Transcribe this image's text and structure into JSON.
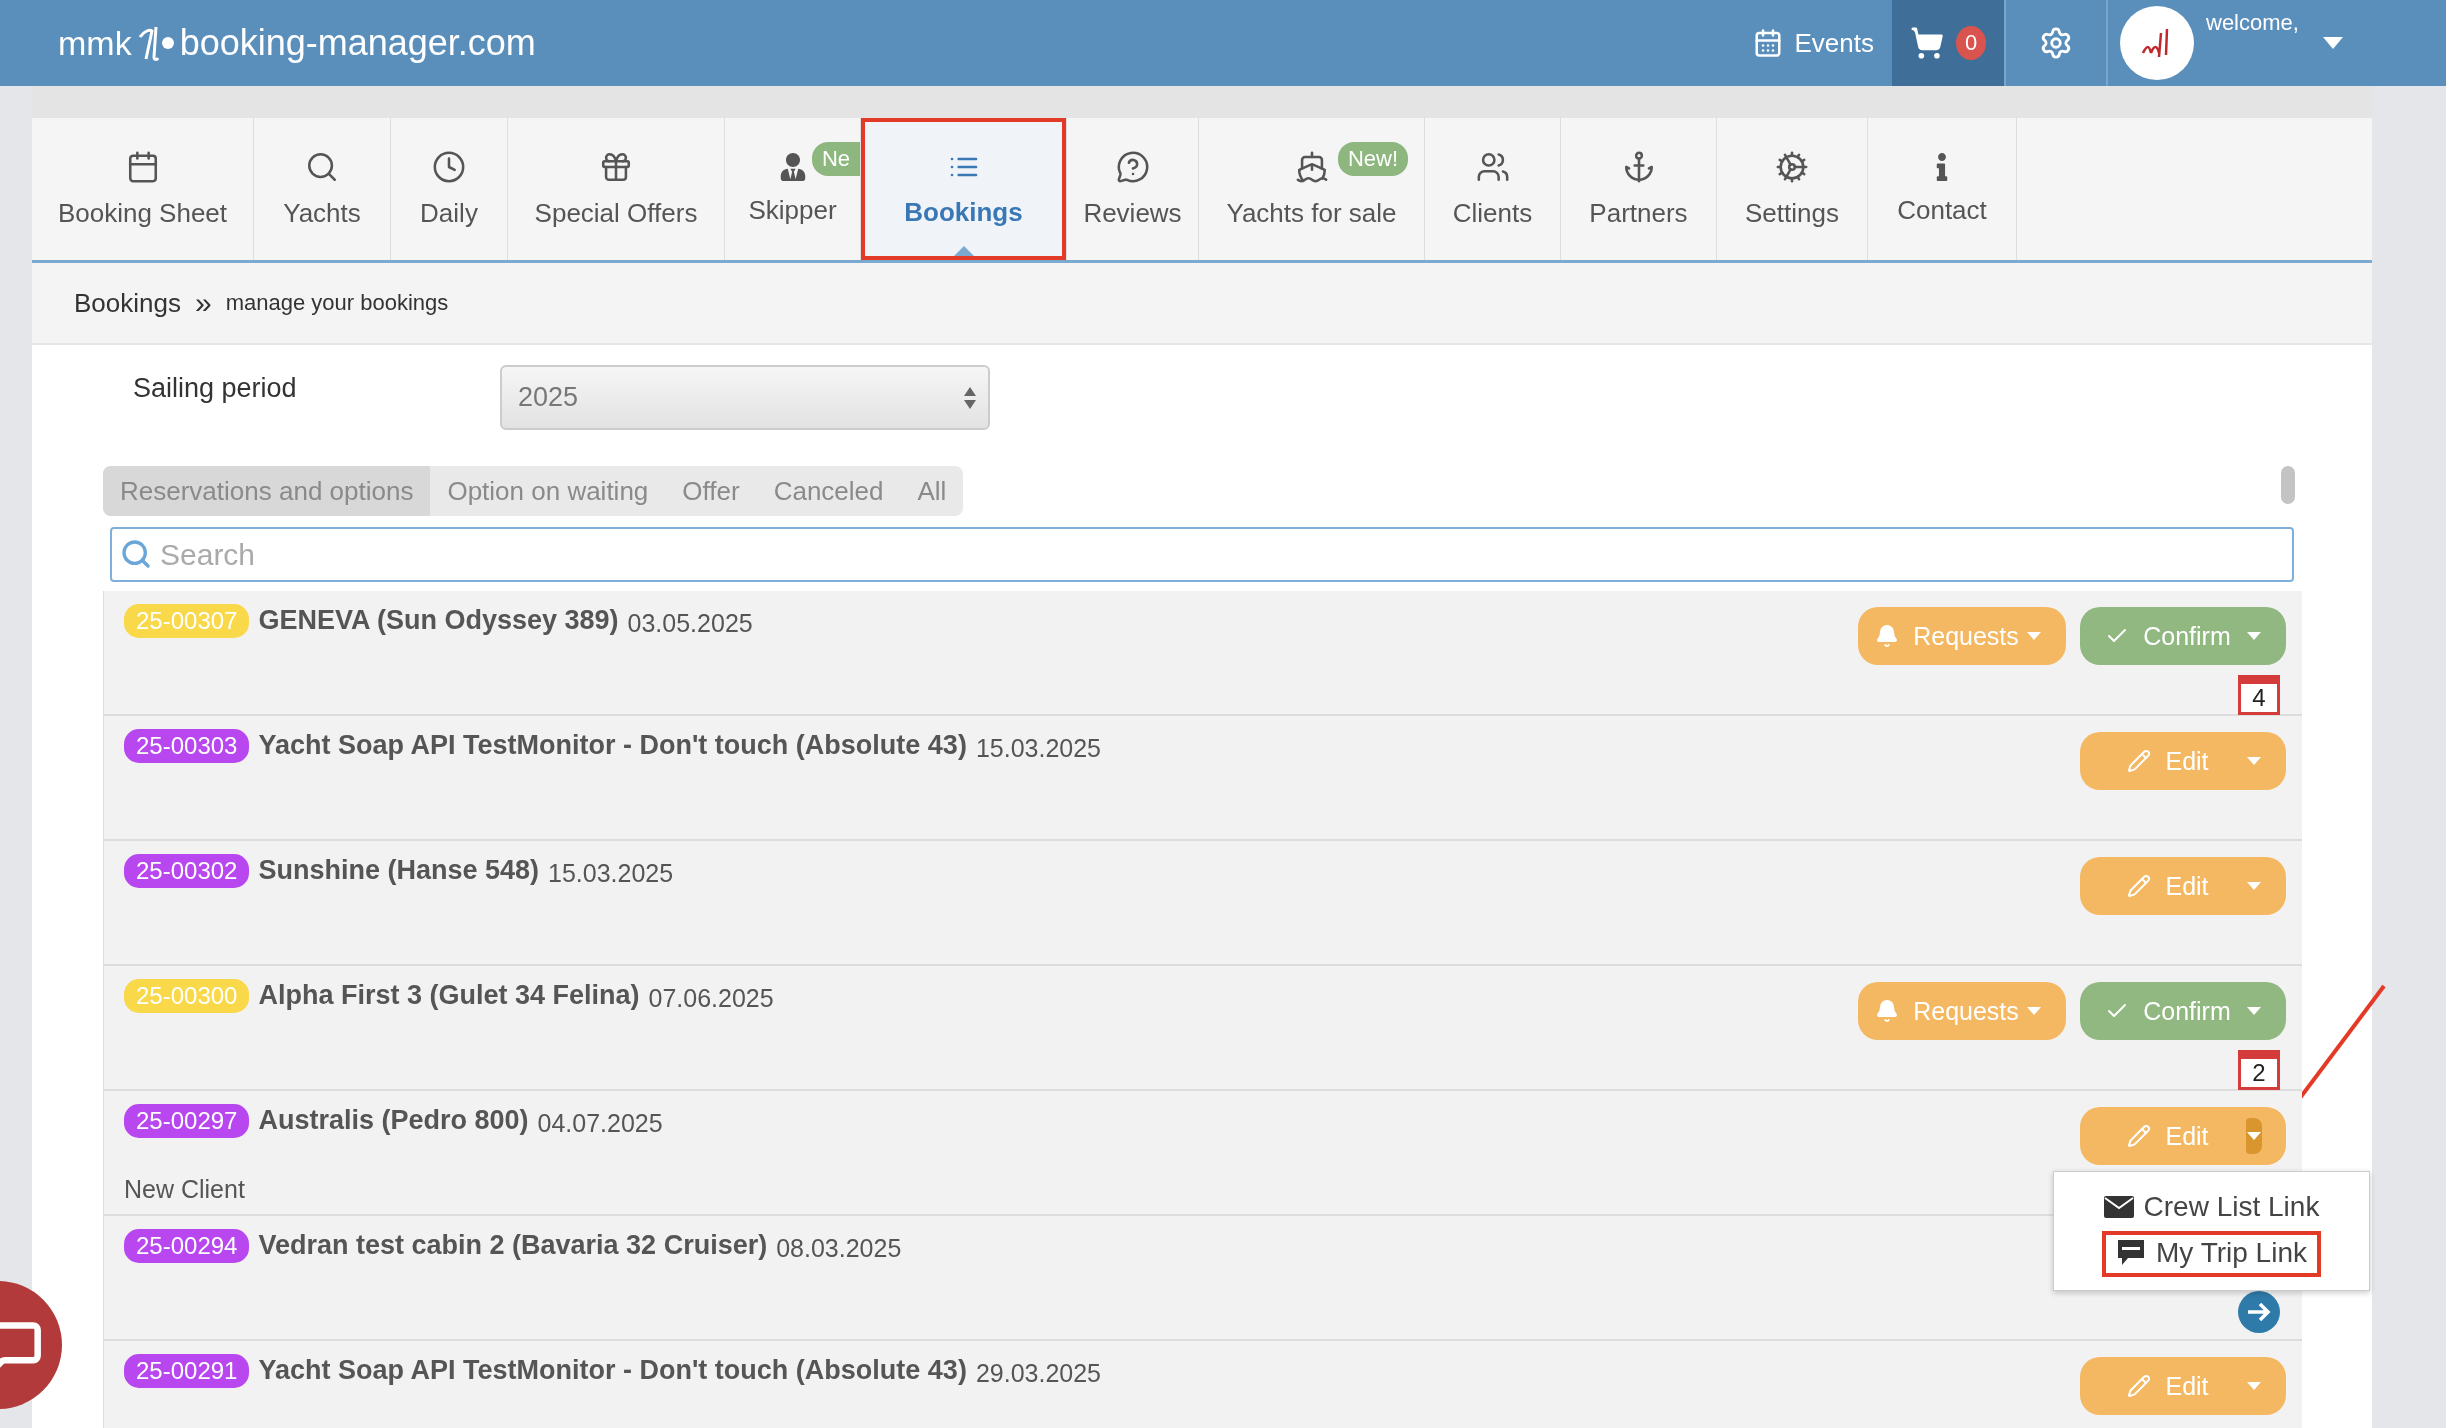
{
  "header": {
    "logo_left": "mmk",
    "logo_right": "booking-manager.com",
    "events": "Events",
    "cart_count": "0",
    "welcome": "welcome,"
  },
  "nav_tabs": [
    {
      "label": "Booking Sheet",
      "selected": false,
      "annotated": false
    },
    {
      "label": "Yachts",
      "selected": false,
      "annotated": false
    },
    {
      "label": "Daily",
      "selected": false,
      "annotated": false
    },
    {
      "label": "Special Offers",
      "selected": false,
      "annotated": false
    },
    {
      "label": "Skipper",
      "selected": false,
      "annotated": false,
      "badge": "Ne"
    },
    {
      "label": "Bookings",
      "selected": true,
      "annotated": true
    },
    {
      "label": "Reviews",
      "selected": false,
      "annotated": false
    },
    {
      "label": "Yachts for sale",
      "selected": false,
      "annotated": false,
      "badge": "New!"
    },
    {
      "label": "Clients",
      "selected": false,
      "annotated": false
    },
    {
      "label": "Partners",
      "selected": false,
      "annotated": false
    },
    {
      "label": "Settings",
      "selected": false,
      "annotated": false
    },
    {
      "label": "Contact",
      "selected": false,
      "annotated": false
    }
  ],
  "breadcrumb": {
    "title": "Bookings",
    "separator": "»",
    "subtitle": "manage your bookings"
  },
  "sailing_period": {
    "label": "Sailing period",
    "value": "2025"
  },
  "filter_tabs": [
    {
      "label": "Reservations and options",
      "selected": true
    },
    {
      "label": "Option on waiting",
      "selected": false
    },
    {
      "label": "Offer",
      "selected": false
    },
    {
      "label": "Canceled",
      "selected": false
    },
    {
      "label": "All",
      "selected": false
    }
  ],
  "search": {
    "placeholder": "Search"
  },
  "bookings": [
    {
      "id": "25-00307",
      "color": "#f9d84a",
      "title": "GENEVA (Sun Odyssey 389)",
      "date": "03.05.2025",
      "actions": [
        {
          "kind": "requests",
          "label": "Requests",
          "expanded": false
        },
        {
          "kind": "confirm",
          "label": "Confirm",
          "expanded": false
        }
      ],
      "indicator": {
        "kind": "calendar",
        "count": "4"
      }
    },
    {
      "id": "25-00303",
      "color": "#b847f0",
      "title": "Yacht Soap API TestMonitor - Don't touch (Absolute 43)",
      "date": "15.03.2025",
      "actions": [
        {
          "kind": "edit",
          "label": "Edit",
          "expanded": false
        }
      ]
    },
    {
      "id": "25-00302",
      "color": "#b847f0",
      "title": "Sunshine (Hanse 548)",
      "date": "15.03.2025",
      "actions": [
        {
          "kind": "edit",
          "label": "Edit",
          "expanded": false
        }
      ]
    },
    {
      "id": "25-00300",
      "color": "#f9d84a",
      "title": "Alpha First 3 (Gulet 34 Felina)",
      "date": "07.06.2025",
      "actions": [
        {
          "kind": "requests",
          "label": "Requests",
          "expanded": false
        },
        {
          "kind": "confirm",
          "label": "Confirm",
          "expanded": false
        }
      ],
      "indicator": {
        "kind": "calendar",
        "count": "2"
      }
    },
    {
      "id": "25-00297",
      "color": "#b847f0",
      "title": "Australis (Pedro 800)",
      "date": "04.07.2025",
      "note": "New Client",
      "actions": [
        {
          "kind": "edit",
          "label": "Edit",
          "expanded": true,
          "menu": [
            {
              "kind": "mail",
              "label": "Crew List Link",
              "annotated": false
            },
            {
              "kind": "sms",
              "label": "My Trip Link",
              "annotated": true
            }
          ]
        }
      ]
    },
    {
      "id": "25-00294",
      "color": "#b847f0",
      "title": "Vedran test cabin 2 (Bavaria 32 Cruiser)",
      "date": "08.03.2025",
      "indicator": {
        "kind": "arrow"
      }
    },
    {
      "id": "25-00291",
      "color": "#b847f0",
      "title": "Yacht Soap API TestMonitor - Don't touch (Absolute 43)",
      "date": "29.03.2025",
      "actions": [
        {
          "kind": "edit",
          "label": "Edit",
          "expanded": false
        }
      ]
    }
  ]
}
